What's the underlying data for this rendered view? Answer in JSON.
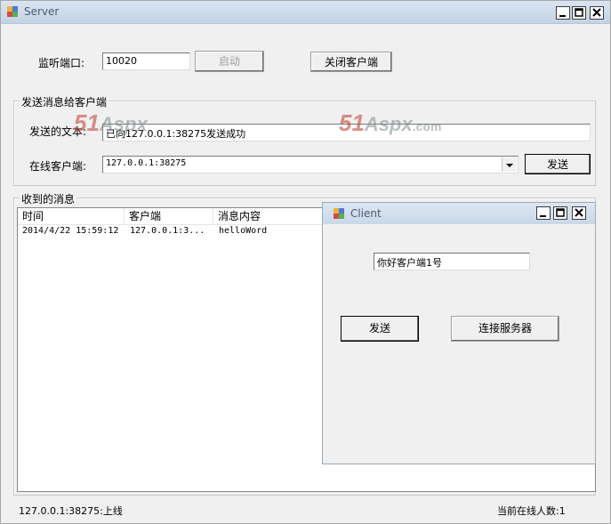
{
  "server": {
    "title": "Server",
    "port_label": "监听端口:",
    "port_value": "10020",
    "start_button": "启动",
    "close_client_button": "关闭客户端",
    "send_group": {
      "title": "发送消息给客户端",
      "text_label": "发送的文本:",
      "text_value": "已向127.0.0.1:38275发送成功",
      "online_label": "在线客户端:",
      "online_selected": "127.0.0.1:38275",
      "send_button": "发送"
    },
    "received_group": {
      "title": "收到的消息",
      "columns": [
        "时间",
        "客户端",
        "消息内容"
      ],
      "rows": [
        {
          "time": "2014/4/22 15:59:12",
          "client": "127.0.0.1:3...",
          "content": "helloWord"
        }
      ]
    },
    "status_left": "127.0.0.1:38275:上线",
    "status_right": "当前在线人数:1"
  },
  "client": {
    "title": "Client",
    "message_value": "你好客户端1号",
    "send_button": "发送",
    "connect_button": "连接服务器"
  },
  "watermark": {
    "num": "51",
    "brand": "Aspx",
    "suffix": ".com"
  },
  "colors": {
    "titlebar_top": "#d9e4f1",
    "titlebar_bottom": "#c3d3e6",
    "window_bg": "#f0f0f0",
    "watermark_red": "#c0392b"
  }
}
